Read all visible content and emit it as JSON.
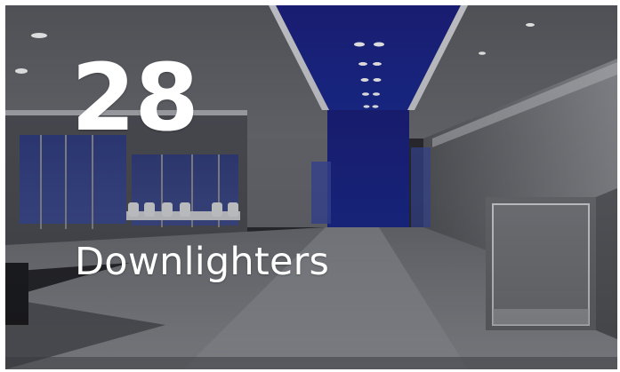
{
  "tile": {
    "count": "28",
    "label": "Downlighters"
  },
  "colors": {
    "accent_blue": "#1a2a8f",
    "text": "#ffffff"
  }
}
